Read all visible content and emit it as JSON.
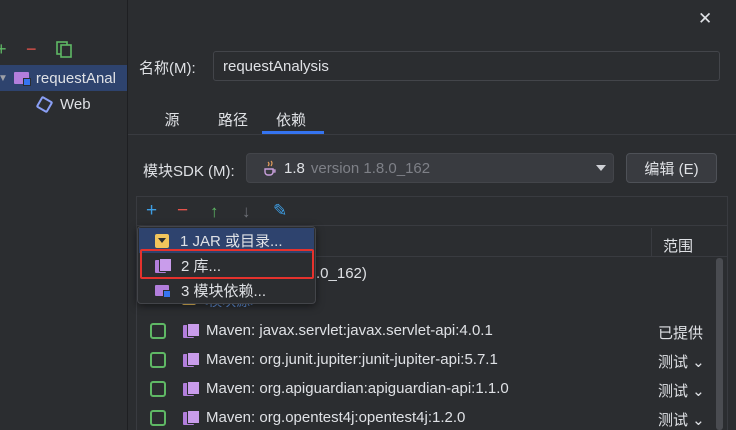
{
  "window": {
    "close_glyph": "✕"
  },
  "tree_toolbar": {
    "add": "+",
    "remove": "−",
    "copy": "⧉"
  },
  "tree": [
    {
      "label": "requestAnal",
      "icon": "module-folder-icon",
      "expanded": true
    },
    {
      "label": "Web",
      "icon": "web-facet-icon"
    }
  ],
  "name_field": {
    "label": "名称(M):",
    "value": "requestAnalysis"
  },
  "tabs": [
    {
      "label": "源"
    },
    {
      "label": "路径"
    },
    {
      "label": "依赖",
      "active": true
    }
  ],
  "sdk": {
    "label": "模块SDK (M):",
    "version": "1.8",
    "detail": "version 1.8.0_162",
    "edit_button": "编辑 (E)"
  },
  "deps_toolbar": {
    "add": "+",
    "remove": "−",
    "up": "↑",
    "down": "↓",
    "edit": "✎"
  },
  "deps_header": {
    "scope_col": "范围"
  },
  "deps_partial": {
    "jdk_suffix": ".0_162)",
    "module_source": "<模块源>"
  },
  "dependencies": [
    {
      "name": "Maven: javax.servlet:javax.servlet-api:4.0.1",
      "scope": "已提供",
      "checked": false
    },
    {
      "name": "Maven: org.junit.jupiter:junit-jupiter-api:5.7.1",
      "scope": "测试 ⌄",
      "checked": false
    },
    {
      "name": "Maven: org.apiguardian:apiguardian-api:1.1.0",
      "scope": "测试 ⌄",
      "checked": false
    },
    {
      "name": "Maven: org.opentest4j:opentest4j:1.2.0",
      "scope": "测试 ⌄",
      "checked": false
    }
  ],
  "add_menu": {
    "items": [
      {
        "label": "1  JAR 或目录...",
        "icon": "jar-folder-icon"
      },
      {
        "label": "2  库...",
        "icon": "library-icon",
        "highlighted": true
      },
      {
        "label": "3  模块依赖...",
        "icon": "module-icon"
      }
    ]
  },
  "colors": {
    "background": "#2b2d30",
    "accent": "#3574f0",
    "add_green": "#5fb865",
    "remove_red": "#e5534b",
    "highlight_red": "#e5322d",
    "library_purple": "#b27edc",
    "jar_yellow": "#f2c55c"
  }
}
